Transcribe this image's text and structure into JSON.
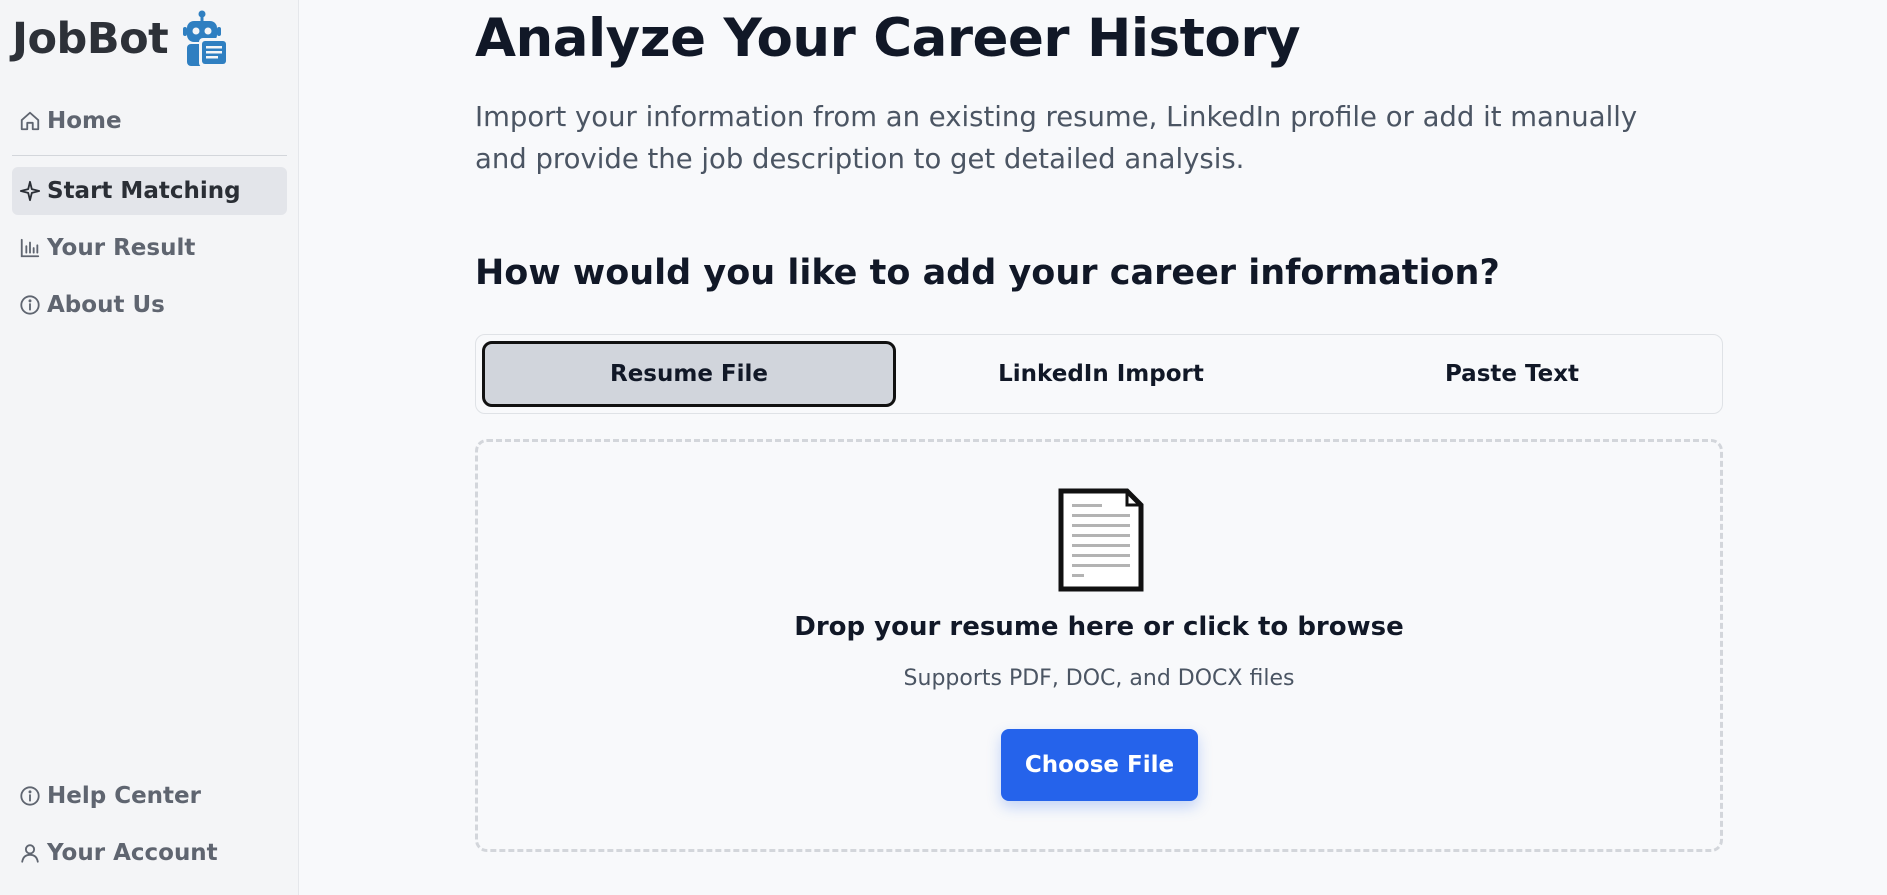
{
  "sidebar": {
    "brand": "JobBot",
    "nav_top": [
      {
        "label": "Home",
        "icon": "home-icon"
      },
      {
        "label": "Start Matching",
        "icon": "sparkle-icon",
        "active": true
      },
      {
        "label": "Your Result",
        "icon": "bar-chart-icon"
      },
      {
        "label": "About Us",
        "icon": "info-icon"
      }
    ],
    "nav_bottom": [
      {
        "label": "Help Center",
        "icon": "info-icon"
      },
      {
        "label": "Your Account",
        "icon": "user-icon"
      }
    ]
  },
  "main": {
    "title": "Analyze Your Career History",
    "subtitle": "Import your information from an existing resume, LinkedIn profile or add it manually and provide the job description to get detailed analysis.",
    "section_heading": "How would you like to add your career information?",
    "tabs": [
      {
        "label": "Resume File",
        "active": true
      },
      {
        "label": "LinkedIn Import",
        "active": false
      },
      {
        "label": "Paste Text",
        "active": false
      }
    ],
    "dropzone": {
      "title": "Drop your resume here or click to browse",
      "hint": "Supports PDF, DOC, and DOCX files",
      "button_label": "Choose File"
    }
  },
  "colors": {
    "primary": "#2563eb",
    "sidebar_bg": "#f4f5f7",
    "active_nav_bg": "#e3e5ea",
    "brand_logo": "#2f7fc1"
  }
}
